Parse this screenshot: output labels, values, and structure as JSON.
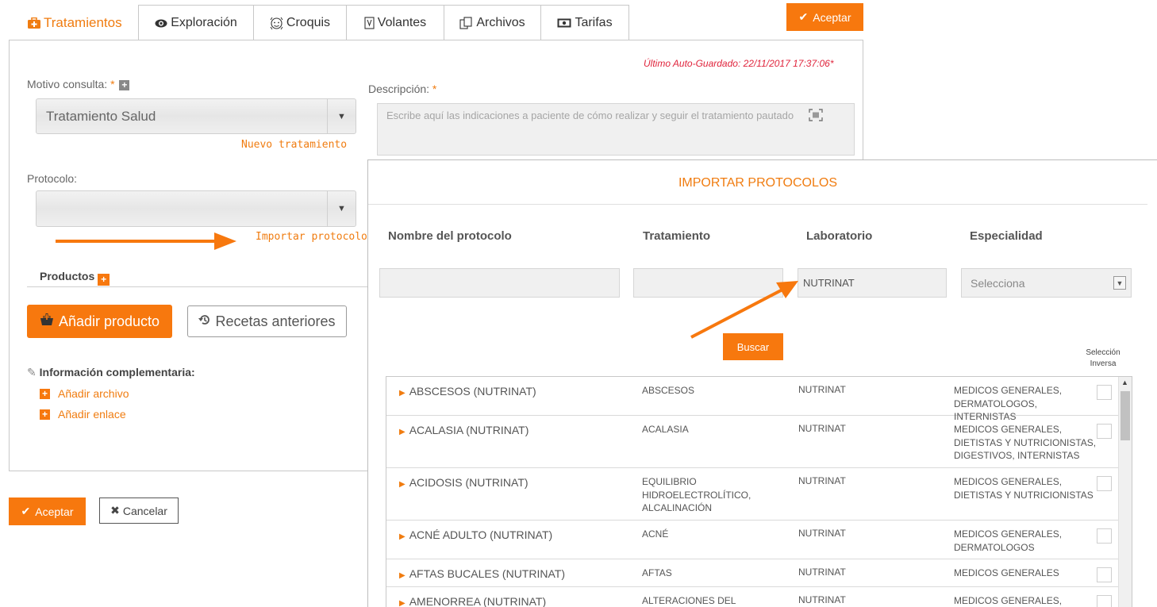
{
  "tabs": [
    {
      "label": "Tratamientos",
      "icon": "medkit-icon"
    },
    {
      "label": "Exploración",
      "icon": "eye-icon"
    },
    {
      "label": "Croquis",
      "icon": "face-icon"
    },
    {
      "label": "Volantes",
      "icon": "document-icon"
    },
    {
      "label": "Archivos",
      "icon": "files-icon"
    },
    {
      "label": "Tarifas",
      "icon": "money-icon"
    }
  ],
  "top_accept": "Aceptar",
  "autosave": "Último Auto-Guardado: 22/11/2017 17:37:06*",
  "motivo": {
    "label": "Motivo consulta:",
    "required": "*",
    "value": "Tratamiento Salud",
    "new_link": "Nuevo tratamiento"
  },
  "descripcion": {
    "label": "Descripción:",
    "required": "*",
    "placeholder": "Escribe aquí las indicaciones a paciente de cómo realizar y seguir el tratamiento pautado"
  },
  "protocolo": {
    "label": "Protocolo:",
    "value": "",
    "import_link": "Importar protocolo"
  },
  "productos": {
    "label": "Productos",
    "add_button": "Añadir producto",
    "recipes_button": "Recetas anteriores"
  },
  "info": {
    "title": "Información complementaria:",
    "add_file": "Añadir archivo",
    "add_link": "Añadir enlace"
  },
  "bottom": {
    "accept": "Aceptar",
    "cancel": "Cancelar"
  },
  "modal": {
    "title": "IMPORTAR PROTOCOLOS",
    "columns": [
      "Nombre del protocolo",
      "Tratamiento",
      "Laboratorio",
      "Especialidad"
    ],
    "filters": {
      "nombre": "",
      "tratamiento": "",
      "laboratorio": "NUTRINAT",
      "especialidad": "Selecciona"
    },
    "search_button": "Buscar",
    "inverse_selection": "Selección Inversa",
    "rows": [
      {
        "name": "ABSCESOS (NUTRINAT)",
        "treatment": "ABSCESOS",
        "lab": "NUTRINAT",
        "specialty": "MEDICOS GENERALES, DERMATOLOGOS, INTERNISTAS"
      },
      {
        "name": "ACALASIA (NUTRINAT)",
        "treatment": "ACALASIA",
        "lab": "NUTRINAT",
        "specialty": "MEDICOS GENERALES, DIETISTAS Y NUTRICIONISTAS, DIGESTIVOS, INTERNISTAS"
      },
      {
        "name": "ACIDOSIS (NUTRINAT)",
        "treatment": "EQUILIBRIO HIDROELECTROLÍTICO, ALCALINACIÓN",
        "lab": "NUTRINAT",
        "specialty": "MEDICOS GENERALES, DIETISTAS Y NUTRICIONISTAS"
      },
      {
        "name": "ACNÉ ADULTO (NUTRINAT)",
        "treatment": "ACNÉ",
        "lab": "NUTRINAT",
        "specialty": "MEDICOS GENERALES, DERMATOLOGOS"
      },
      {
        "name": "AFTAS BUCALES (NUTRINAT)",
        "treatment": "AFTAS",
        "lab": "NUTRINAT",
        "specialty": "MEDICOS GENERALES"
      },
      {
        "name": "AMENORREA (NUTRINAT)",
        "treatment": "ALTERACIONES DEL CICLO",
        "lab": "NUTRINAT",
        "specialty": "MEDICOS GENERALES,"
      }
    ]
  },
  "colors": {
    "accent": "#f7780e",
    "autosave": "#e0243c"
  }
}
